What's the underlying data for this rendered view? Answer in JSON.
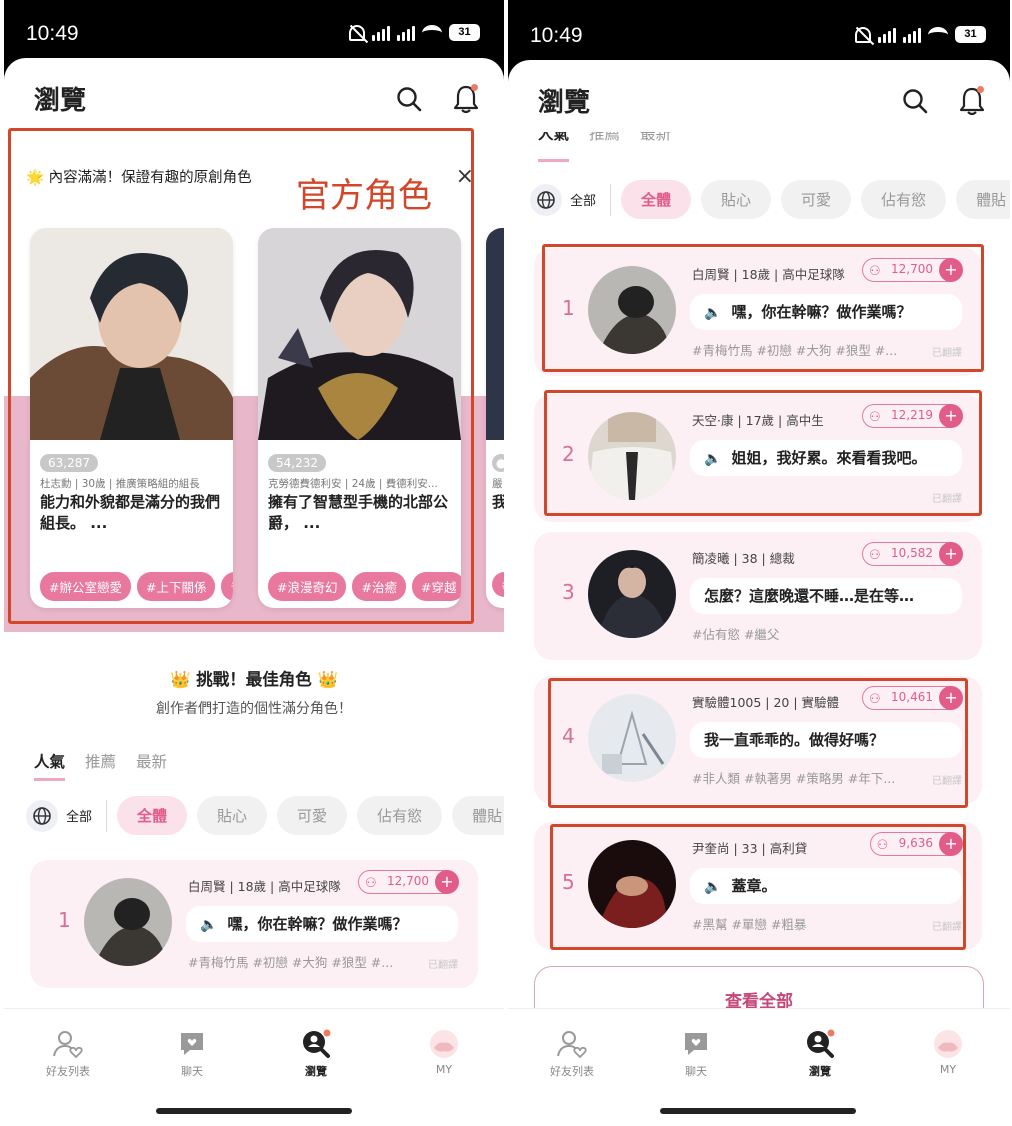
{
  "status": {
    "time": "10:49",
    "battery": "31"
  },
  "header": {
    "title": "瀏覽"
  },
  "official": {
    "notice": "🌟 內容滿滿！保證有趣的原創角色",
    "annotation": "官方角色",
    "close": "×",
    "cards": [
      {
        "count": "63,287",
        "sub": "杜志勳 | 30歲 | 推廣策略組的組長",
        "desc": "能力和外貌都是滿分的我們組長。 ...",
        "tags": [
          "#辦公室戀愛",
          "#上下關係",
          "#"
        ]
      },
      {
        "count": "54,232",
        "sub": "克勞德費德利安 | 24歲 | 費德利安...",
        "desc": "擁有了智慧型手機的北部公爵， ...",
        "tags": [
          "#浪漫奇幻",
          "#治癒",
          "#穿越"
        ]
      },
      {
        "count": "",
        "sub": "嚴",
        "desc": "我懂",
        "tags": [
          "#"
        ]
      }
    ]
  },
  "challenge": {
    "title": "👑 挑戰！最佳角色 👑",
    "subtitle": "創作者們打造的個性滿分角色！"
  },
  "tabs": [
    "人氣",
    "推薦",
    "最新"
  ],
  "filters": {
    "all": "全部",
    "chips": [
      "全體",
      "貼心",
      "可愛",
      "佔有慾",
      "體貼"
    ]
  },
  "ranking": [
    {
      "rank": "1",
      "info": "白周賢 | 18歲 | 高中足球隊",
      "fans": "12,700",
      "line": "嘿，你在幹嘛？做作業嗎？",
      "voice": true,
      "tags": "#青梅竹馬 #初戀 #大狗 #狼型 #...",
      "translated": "已翻譯"
    },
    {
      "rank": "2",
      "info": "天空·康 | 17歲 | 高中生",
      "fans": "12,219",
      "line": "姐姐，我好累。來看看我吧。",
      "voice": true,
      "tags": "",
      "translated": "已翻譯"
    },
    {
      "rank": "3",
      "info": "簡凌曦 | 38 | 總裁",
      "fans": "10,582",
      "line": "怎麼？這麼晚還不睡…是在等…",
      "voice": false,
      "tags": "#佔有慾 #繼父",
      "translated": ""
    },
    {
      "rank": "4",
      "info": "實驗體1005 | 20 | 實驗體",
      "fans": "10,461",
      "line": "我一直乖乖的。做得好嗎？",
      "voice": false,
      "tags": "#非人類 #執著男 #策略男 #年下...",
      "translated": "已翻譯"
    },
    {
      "rank": "5",
      "info": "尹奎尚 | 33 | 高利貸",
      "fans": "9,636",
      "line": "蓋章。",
      "voice": true,
      "tags": "#黑幫 #單戀 #粗暴",
      "translated": "已翻譯"
    }
  ],
  "viewall": "查看全部",
  "nav": [
    "好友列表",
    "聊天",
    "瀏覽",
    "MY"
  ],
  "colors": {
    "accent": "#e25c8a",
    "annotation": "#d2472a",
    "band": "#e8b7c9"
  }
}
